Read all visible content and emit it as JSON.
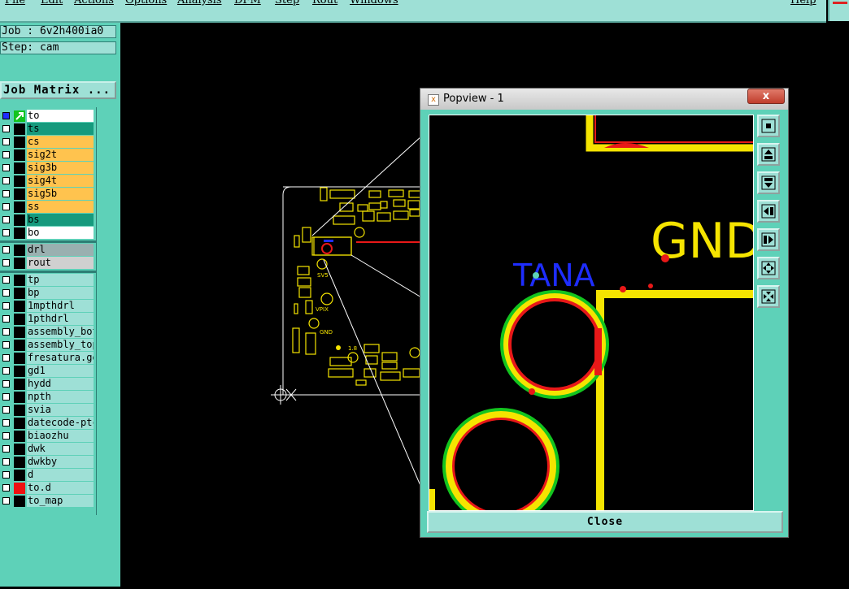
{
  "menubar": {
    "items": [
      "File",
      "Edit",
      "Actions",
      "Options",
      "Analysis",
      "DFM",
      "Step",
      "Rout",
      "Windows"
    ],
    "help": "Help"
  },
  "job": {
    "job_label": "Job : 6v2h400ia0",
    "step_label": "Step: cam",
    "matrix_button": "Job Matrix ..."
  },
  "layers": [
    {
      "name": "to",
      "color": "#ffffff",
      "special": "cursor"
    },
    {
      "name": "ts",
      "color": "#169a7d"
    },
    {
      "name": "cs",
      "color": "#ffc34e"
    },
    {
      "name": "sig2t",
      "color": "#ffc34e"
    },
    {
      "name": "sig3b",
      "color": "#ffc34e"
    },
    {
      "name": "sig4t",
      "color": "#ffc34e"
    },
    {
      "name": "sig5b",
      "color": "#ffc34e"
    },
    {
      "name": "ss",
      "color": "#ffc34e"
    },
    {
      "name": "bs",
      "color": "#169a7d"
    },
    {
      "name": "bo",
      "color": "#ffffff"
    },
    {
      "name": "drl",
      "color": "#9ab0b0"
    },
    {
      "name": "rout",
      "color": "#d0d0d0"
    },
    {
      "name": "tp",
      "color": "#9ee0d6"
    },
    {
      "name": "bp",
      "color": "#9ee0d6"
    },
    {
      "name": "1mpthdrl",
      "color": "#9ee0d6"
    },
    {
      "name": "1pthdrl",
      "color": "#9ee0d6"
    },
    {
      "name": "assembly_bot",
      "color": "#9ee0d6"
    },
    {
      "name": "assembly_top",
      "color": "#9ee0d6"
    },
    {
      "name": "fresatura.gerber",
      "color": "#9ee0d6"
    },
    {
      "name": "gd1",
      "color": "#9ee0d6"
    },
    {
      "name": "hydd",
      "color": "#9ee0d6"
    },
    {
      "name": "npth",
      "color": "#9ee0d6"
    },
    {
      "name": "svia",
      "color": "#9ee0d6"
    },
    {
      "name": "datecode-ptc",
      "color": "#9ee0d6"
    },
    {
      "name": "biaozhu",
      "color": "#9ee0d6"
    },
    {
      "name": "dwk",
      "color": "#9ee0d6"
    },
    {
      "name": "dwkby",
      "color": "#9ee0d6"
    },
    {
      "name": "d",
      "color": "#9ee0d6"
    },
    {
      "name": "to.d",
      "color": "#9ee0d6",
      "swatch": "#ee1111"
    },
    {
      "name": "to_map",
      "color": "#9ee0d6"
    }
  ],
  "popview": {
    "title": "Popview - 1",
    "close_x": "x",
    "close_button": "Close",
    "labels": {
      "gnd": "GND",
      "tana": "TANA"
    },
    "tools": [
      "zoom-fit-icon",
      "pan-up-icon",
      "pan-down-icon",
      "pan-left-icon",
      "pan-right-icon",
      "zoom-in-icon",
      "zoom-out-icon"
    ]
  },
  "board": {
    "labels": [
      "SV5",
      "VPIX",
      "GND",
      "1.8"
    ]
  },
  "colors": {
    "panel": "#5ed1b8",
    "panel_light": "#9ee0d6",
    "trace": "#f5e400",
    "pad_red": "#e81818",
    "pad_green": "#13c41f",
    "text_blue": "#1e2dff"
  }
}
